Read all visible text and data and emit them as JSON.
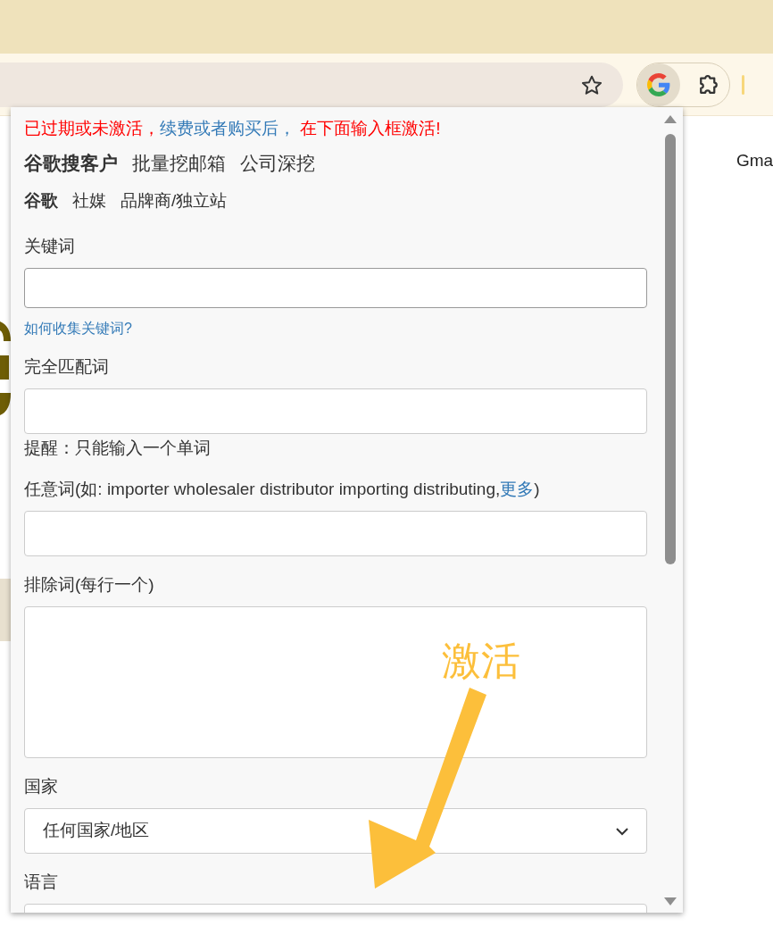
{
  "page": {
    "text": "Gma"
  },
  "notice": [
    {
      "text": "已过期或未激活，",
      "kind": "warning"
    },
    {
      "text": "续费或者购买后，",
      "kind": "link"
    },
    {
      "text": " 在下面输入框激活!",
      "kind": "warning"
    }
  ],
  "main_tabs": [
    {
      "label": "谷歌搜客户",
      "selected": true
    },
    {
      "label": "批量挖邮箱",
      "selected": false
    },
    {
      "label": "公司深挖",
      "selected": false
    }
  ],
  "sub_tabs": [
    {
      "label": "谷歌",
      "selected": true
    },
    {
      "label": "社媒",
      "selected": false
    },
    {
      "label": "品牌商/独立站",
      "selected": false
    }
  ],
  "fields": [
    {
      "kind": "textarea",
      "label": "关键词",
      "help_link": "如何收集关键词?"
    },
    {
      "kind": "input",
      "label": "完全匹配词",
      "note": "提醒：只能输入一个单词"
    },
    {
      "kind": "input",
      "label": "任意词(如: importer wholesaler distributor importing distributing,",
      "label_link": "更多",
      "label_end": ")"
    },
    {
      "kind": "tall_textarea",
      "label": "排除词(每行一个)"
    },
    {
      "kind": "select",
      "label": "国家",
      "value": "任何国家/地区"
    },
    {
      "kind": "select",
      "label": "语言"
    }
  ],
  "annotation": {
    "text": "激活"
  }
}
